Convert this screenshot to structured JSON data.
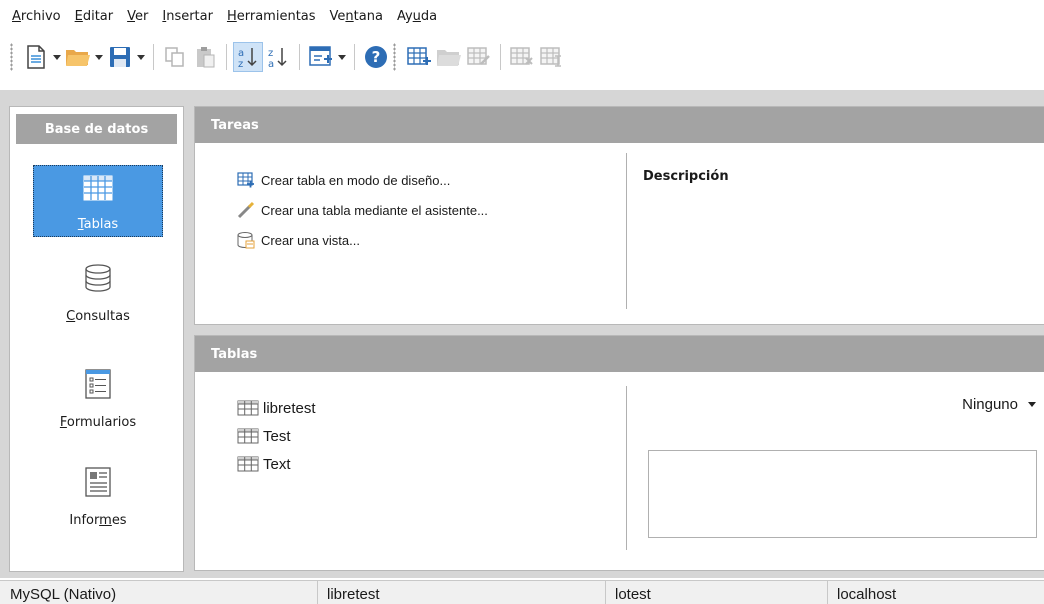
{
  "menubar": {
    "items": [
      {
        "pre": "",
        "u": "A",
        "post": "rchivo"
      },
      {
        "pre": "",
        "u": "E",
        "post": "ditar"
      },
      {
        "pre": "",
        "u": "V",
        "post": "er"
      },
      {
        "pre": "",
        "u": "I",
        "post": "nsertar"
      },
      {
        "pre": "",
        "u": "H",
        "post": "erramientas"
      },
      {
        "pre": "Ve",
        "u": "n",
        "post": "tana"
      },
      {
        "pre": "Ay",
        "u": "u",
        "post": "da"
      }
    ]
  },
  "toolbar": {
    "icons": [
      "new-document-icon",
      "open-folder-icon",
      "save-icon",
      "copy-icon",
      "paste-icon",
      "sort-ascending-icon",
      "sort-descending-icon",
      "form-wizard-icon",
      "help-icon",
      "create-table-icon",
      "open-object-icon",
      "edit-object-icon",
      "delete-object-icon",
      "rename-object-icon"
    ],
    "accent": "#3a8fd8"
  },
  "sidebar": {
    "header": "Base de datos",
    "items": [
      {
        "pre": "",
        "u": "T",
        "post": "ablas",
        "icon": "table-icon"
      },
      {
        "pre": "",
        "u": "C",
        "post": "onsultas",
        "icon": "database-icon"
      },
      {
        "pre": "",
        "u": "F",
        "post": "ormularios",
        "icon": "form-icon"
      },
      {
        "pre": "Infor",
        "u": "m",
        "post": "es",
        "icon": "report-icon"
      }
    ],
    "active_color": "#4a99e3"
  },
  "tasks": {
    "header": "Tareas",
    "items": [
      {
        "label": "Crear tabla en modo de diseño...",
        "icon": "table-design-icon"
      },
      {
        "label": "Crear una tabla mediante el asistente...",
        "icon": "wizard-wand-icon"
      },
      {
        "label": "Crear una vista...",
        "icon": "create-view-icon"
      }
    ],
    "description_title": "Descripción"
  },
  "tables": {
    "header": "Tablas",
    "items": [
      "libretest",
      "Test",
      "Text"
    ],
    "preview_value": "Ninguno"
  },
  "statusbar": {
    "cells": [
      "MySQL (Nativo)",
      "libretest",
      "lotest",
      "localhost"
    ]
  }
}
